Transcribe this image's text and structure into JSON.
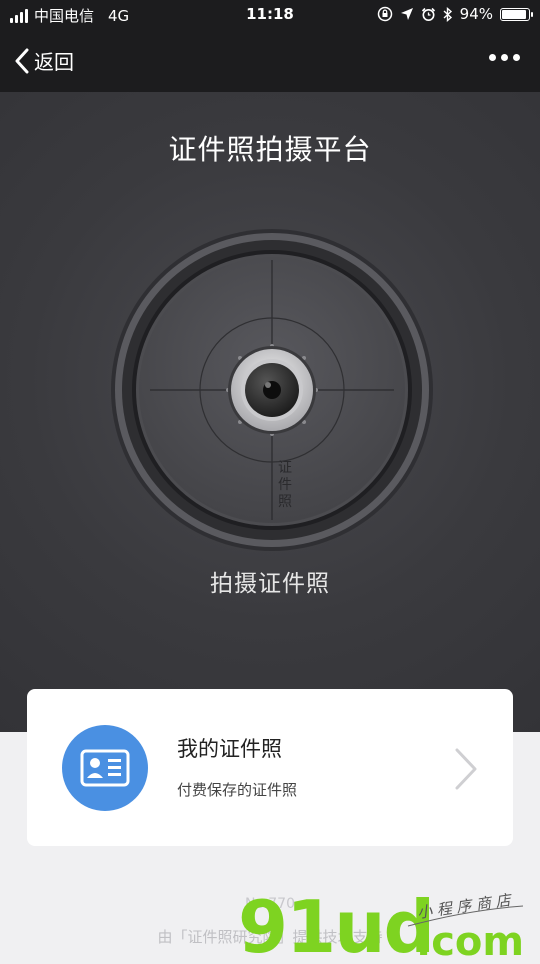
{
  "status_bar": {
    "carrier": "中国电信",
    "network": "4G",
    "time": "11:18",
    "battery": "94%",
    "battery_level": 0.94
  },
  "nav": {
    "back_label": "返回"
  },
  "hero": {
    "title": "证件照拍摄平台",
    "dial_label": "证件照",
    "shoot_label": "拍摄证件照"
  },
  "card": {
    "title": "我的证件照",
    "subtitle": "付费保存的证件照"
  },
  "footer": {
    "number": "No.770",
    "provider": "由「证件照研究院」提供技术支持"
  },
  "watermark": {
    "brand": "91ud",
    "tld": ".com",
    "tagline": "小程序商店"
  },
  "colors": {
    "nav_bg": "#1c1c1e",
    "hero_bg": "#3a3a3e",
    "accent_blue": "#4a90e2",
    "watermark_green": "#7ed321"
  }
}
